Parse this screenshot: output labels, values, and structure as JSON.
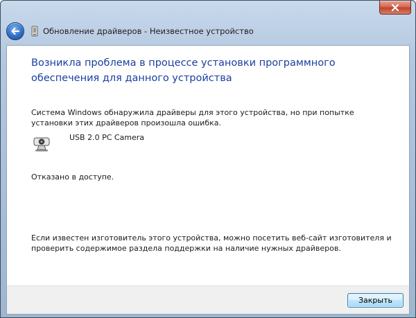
{
  "window": {
    "title": "Обновление драйверов - Неизвестное устройство"
  },
  "content": {
    "heading": "Возникла проблема в процессе установки программного обеспечения для данного устройства",
    "description": "Система Windows обнаружила драйверы для этого устройства, но при попытке установки этих драйверов произошла ошибка.",
    "device_name": "USB 2.0 PC Camera",
    "error_message": "Отказано в доступе.",
    "note": "Если известен изготовитель этого устройства, можно посетить веб-сайт изготовителя и проверить содержимое раздела поддержки на наличие нужных драйверов."
  },
  "footer": {
    "close_label": "Закрыть"
  },
  "icons": {
    "window_close": "close-icon",
    "back": "back-arrow-icon",
    "device": "device-icon",
    "camera": "webcam-icon"
  },
  "colors": {
    "heading": "#1a3e9f",
    "close_button": "#c2432b",
    "back_button": "#2f6fc6"
  }
}
